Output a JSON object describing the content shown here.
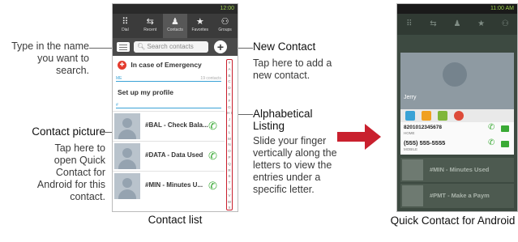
{
  "callouts": {
    "search": {
      "text": "Type in the name you want to search."
    },
    "new_contact": {
      "title": "New Contact",
      "text": "Tap here to add a new contact."
    },
    "alpha": {
      "title": "Alphabetical Listing",
      "text": "Slide your finger vertically along the letters to view the entries under a specific letter."
    },
    "picture": {
      "title": "Contact picture",
      "text": "Tap here to open Quick Contact for Android for this contact."
    }
  },
  "captions": {
    "left": "Contact list",
    "right": "Quick Contact for Android"
  },
  "phone1": {
    "time": "12:00",
    "tabs": [
      {
        "label": "Dial",
        "icon": "dialpad-icon"
      },
      {
        "label": "Recent",
        "icon": "recent-icon"
      },
      {
        "label": "Contacts",
        "icon": "contacts-icon"
      },
      {
        "label": "Favorites",
        "icon": "star-icon"
      },
      {
        "label": "Groups",
        "icon": "groups-icon"
      }
    ],
    "search_placeholder": "Search contacts",
    "ice_label": "In case of Emergency",
    "me_header": "ME",
    "me_count": "19 contacts",
    "setup_profile": "Set up my profile",
    "section_letter": "#",
    "contacts": [
      "#BAL - Check Bala...",
      "#DATA - Data Used",
      "#MIN - Minutes U..."
    ],
    "alphabet": "# A B C D E F G H I J K L M N O P Q R S T U V W X Y Z"
  },
  "phone2": {
    "time": "11:00 AM",
    "contact_name": "Jerry",
    "numbers": [
      {
        "number": "8201012345678",
        "type": "HOME"
      },
      {
        "number": "(555) 555-5555",
        "type": "MOBILE"
      }
    ],
    "dim_contacts": [
      "#MIN - Minutes Used",
      "#PMT - Make a Paym"
    ]
  },
  "colors": {
    "accent_red": "#c9202e",
    "call_green": "#3aaa35",
    "section_blue": "#3aa3d6"
  }
}
